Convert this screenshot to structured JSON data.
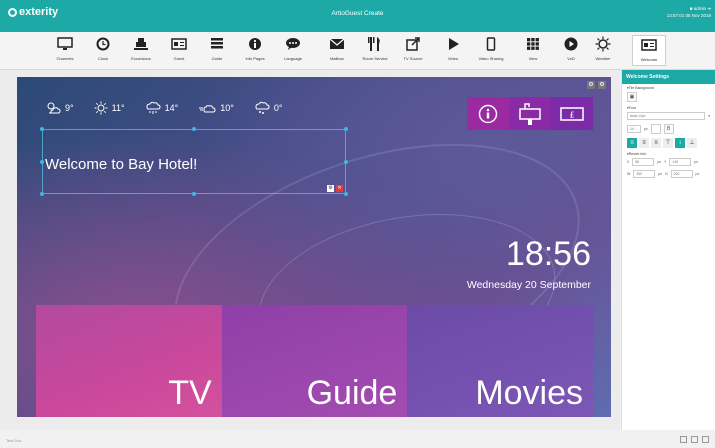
{
  "app": {
    "logo_text": "exterity",
    "title": "ArtioGuest Create",
    "user_name": "admin",
    "user_datetime": "13:57:01 05 Nov 2018"
  },
  "toolbar": {
    "items": [
      {
        "label": "Channels",
        "icon": "tv-icon"
      },
      {
        "label": "Clock",
        "icon": "clock-icon"
      },
      {
        "label": "Excursions",
        "icon": "excursion-icon"
      },
      {
        "label": "Guest",
        "icon": "guest-card-icon"
      },
      {
        "label": "Guide",
        "icon": "list-icon"
      },
      {
        "label": "Info Pages",
        "icon": "info-icon"
      },
      {
        "label": "Language",
        "icon": "speech-bubble-icon"
      },
      {
        "label": "Mailbox",
        "icon": "mail-icon"
      },
      {
        "label": "Room Service",
        "icon": "cutlery-icon"
      },
      {
        "label": "TV Source",
        "icon": "external-icon"
      },
      {
        "label": "Video",
        "icon": "play-icon"
      },
      {
        "label": "Video Sharing",
        "icon": "phone-icon"
      },
      {
        "label": "View",
        "icon": "grid-icon"
      },
      {
        "label": "VoD",
        "icon": "play-circle-icon"
      },
      {
        "label": "Weather",
        "icon": "sun-icon"
      },
      {
        "label": "Welcome",
        "icon": "welcome-card-icon"
      }
    ]
  },
  "screen": {
    "weather": [
      {
        "icon": "sun-cloud-icon",
        "temp": "9°"
      },
      {
        "icon": "sun-icon",
        "temp": "11°"
      },
      {
        "icon": "rain-cloud-icon",
        "temp": "14°"
      },
      {
        "icon": "wind-cloud-icon",
        "temp": "10°"
      },
      {
        "icon": "snow-cloud-icon",
        "temp": "0°"
      }
    ],
    "welcome_text": "Welcome to Bay Hotel!",
    "time": "18:56",
    "date": "Wednesday 20 September",
    "menu": [
      "TV",
      "Guide",
      "Movies"
    ]
  },
  "sidebar": {
    "title": "Welcome Settings",
    "tile_bg_label": "▾Tile Background",
    "font_label": "▾Font",
    "font_value": "Arial,14px",
    "size_value": "14",
    "size_unit": "px",
    "bold_label": "B",
    "resize_label": "▾Resize Info",
    "x_label": "X",
    "x_value": "80",
    "x_unit": "px",
    "y_label": "Y",
    "y_value": "140",
    "y_unit": "px",
    "w_label": "W",
    "w_value": "300",
    "w_unit": "px",
    "h_label": "H",
    "h_value": "200",
    "h_unit": "px"
  },
  "status": {
    "text": "Test Doc"
  },
  "colors": {
    "accent": "#1da9a5",
    "tile_tv": "#c9489c",
    "tile_guide": "#a34cb0",
    "tile_movies": "#7d57b5"
  }
}
